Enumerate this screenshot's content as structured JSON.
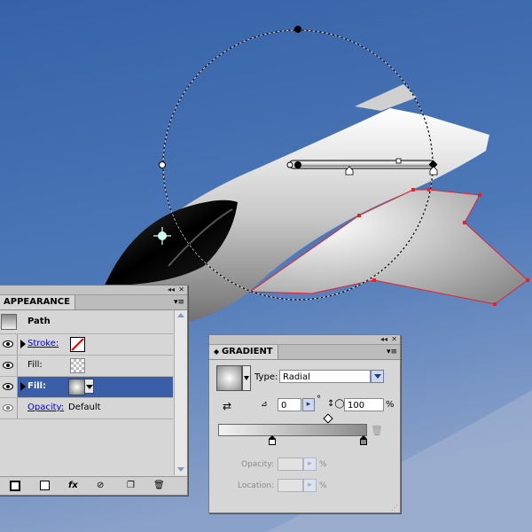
{
  "appearance": {
    "tab": "APPEARANCE",
    "collapse_icon": "◂◂",
    "close_icon": "✕",
    "menu_icon": "▾≡",
    "header_label": "Path",
    "rows": [
      {
        "label": "Stroke:",
        "kind": "stroke"
      },
      {
        "label": "Fill:",
        "kind": "fill-transparent"
      },
      {
        "label": "Fill:",
        "kind": "fill-gradient"
      },
      {
        "label": "Opacity:",
        "value": "Default"
      }
    ],
    "footer_fx": "fx"
  },
  "gradient": {
    "tab": "GRADIENT",
    "collapse_icon": "◂◂",
    "close_icon": "✕",
    "menu_icon": "▾≡",
    "type_label": "Type:",
    "type_value": "Radial",
    "angle_value": "0",
    "degree_symbol": "°",
    "aspect_value": "100",
    "percent_symbol": "%",
    "opacity_label": "Opacity:",
    "location_label": "Location:"
  },
  "colors": {
    "sky_top": "#3a64a6",
    "selection_path": "#e8202a",
    "selected_row": "#3a5fa8",
    "panel_bg": "#d6d6d6"
  }
}
